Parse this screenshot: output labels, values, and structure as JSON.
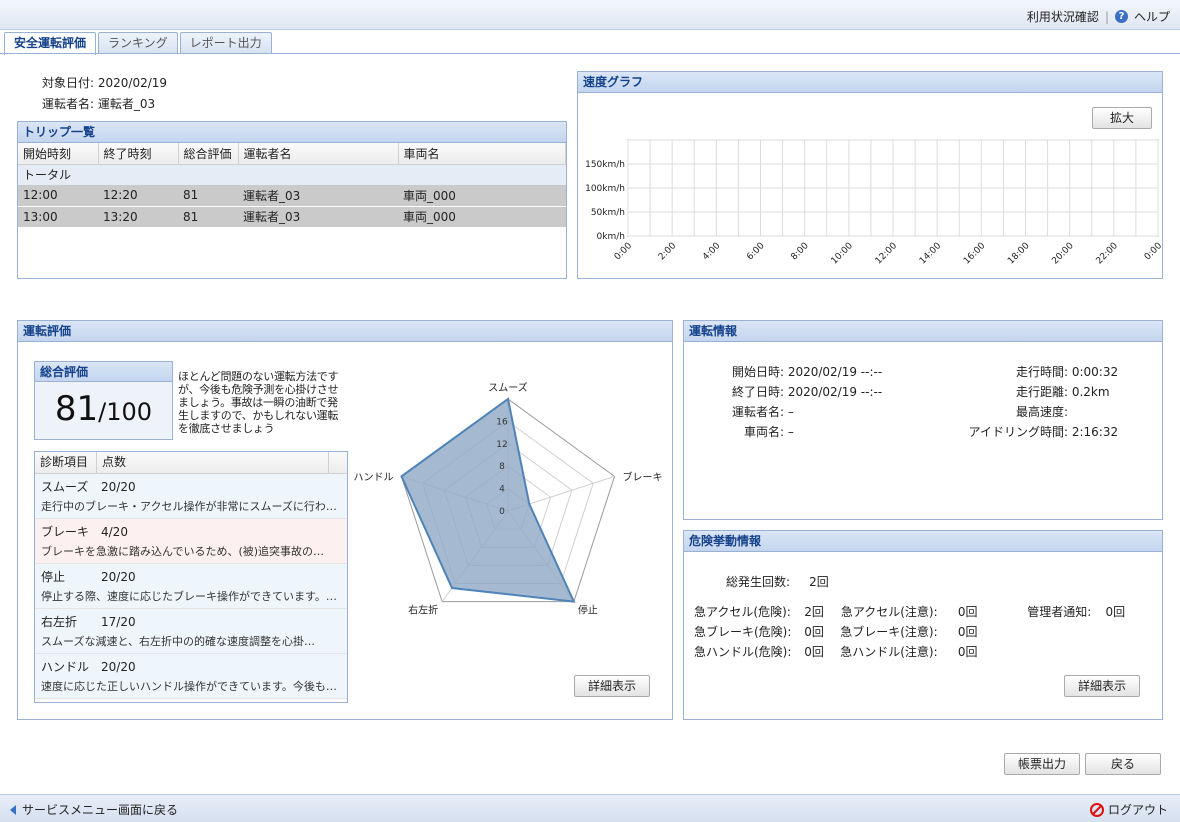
{
  "header": {
    "usage_link": "利用状況確認",
    "help_link": "ヘルプ"
  },
  "tabs": [
    {
      "label": "安全運転評価",
      "active": true
    },
    {
      "label": "ランキング",
      "active": false
    },
    {
      "label": "レポート出力",
      "active": false
    }
  ],
  "target": {
    "date_label": "対象日付:",
    "date": "2020/02/19",
    "driver_label": "運転者名:",
    "driver": "運転者_03"
  },
  "trips": {
    "title": "トリップ一覧",
    "columns": [
      "開始時刻",
      "終了時刻",
      "総合評価",
      "運転者名",
      "車両名"
    ],
    "total_label": "トータル",
    "rows": [
      [
        "12:00",
        "12:20",
        "81",
        "運転者_03",
        "車両_000"
      ],
      [
        "13:00",
        "13:20",
        "81",
        "運転者_03",
        "車両_000"
      ]
    ]
  },
  "speed_graph": {
    "title": "速度グラフ",
    "zoom_label": "拡大",
    "y_ticks": [
      "0km/h",
      "50km/h",
      "100km/h",
      "150km/h"
    ],
    "x_ticks": [
      "0:00",
      "2:00",
      "4:00",
      "6:00",
      "8:00",
      "10:00",
      "12:00",
      "14:00",
      "16:00",
      "18:00",
      "20:00",
      "22:00",
      "0:00"
    ]
  },
  "evaluation": {
    "title": "運転評価",
    "score_title": "総合評価",
    "score": "81",
    "score_max": "/100",
    "comment": "ほとんど問題のない運転方法ですが、今後も危険予測を心掛けさせましょう。事故は一瞬の油断で発生しますので、かもしれない運転を徹底させましょう",
    "diag_columns": [
      "診断項目",
      "点数"
    ],
    "items": [
      {
        "name": "スムーズ",
        "score": "20/20",
        "desc": "走行中のブレーキ・アクセル操作が非常にスムーズに行わ…",
        "tone": "blue"
      },
      {
        "name": "ブレーキ",
        "score": "4/20",
        "desc": "ブレーキを急激に踏み込んでいるため、(被)追突事故の…",
        "tone": "pink"
      },
      {
        "name": "停止",
        "score": "20/20",
        "desc": "停止する際、速度に応じたブレーキ操作ができています。…",
        "tone": "blue"
      },
      {
        "name": "右左折",
        "score": "17/20",
        "desc": "スムーズな減速と、右左折中の的確な速度調整を心掛…",
        "tone": "blue"
      },
      {
        "name": "ハンドル",
        "score": "20/20",
        "desc": "速度に応じた正しいハンドル操作ができています。今後も…",
        "tone": "blue"
      }
    ],
    "detail_label": "詳細表示"
  },
  "chart_data": {
    "type": "radar",
    "categories": [
      "スムーズ",
      "ブレーキ",
      "停止",
      "右左折",
      "ハンドル"
    ],
    "values": [
      20,
      4,
      20,
      17,
      20
    ],
    "ticks": [
      "0",
      "4",
      "8",
      "12",
      "16"
    ],
    "range": [
      0,
      20
    ],
    "fill": "#8fa9c4",
    "stroke": "#4f83b8"
  },
  "driving_info": {
    "title": "運転情報",
    "left": [
      {
        "k": "開始日時:",
        "v": "2020/02/19 --:--"
      },
      {
        "k": "終了日時:",
        "v": "2020/02/19 --:--"
      },
      {
        "k": "運転者名:",
        "v": "–"
      },
      {
        "k": "車両名:",
        "v": "–"
      }
    ],
    "right": [
      {
        "k": "走行時間:",
        "v": "0:00:32"
      },
      {
        "k": "走行距離:",
        "v": "0.2km"
      },
      {
        "k": "最高速度:",
        "v": ""
      },
      {
        "k": "アイドリング時間:",
        "v": "2:16:32"
      }
    ]
  },
  "danger_info": {
    "title": "危険挙動情報",
    "total_label": "総発生回数:",
    "total": "2回",
    "rows": [
      {
        "k1": "急アクセル(危険):",
        "v1": "2回",
        "k2": "急アクセル(注意):",
        "v2": "0回",
        "k3": "管理者通知:",
        "v3": "0回"
      },
      {
        "k1": "急ブレーキ(危険):",
        "v1": "0回",
        "k2": "急ブレーキ(注意):",
        "v2": "0回"
      },
      {
        "k1": "急ハンドル(危険):",
        "v1": "0回",
        "k2": "急ハンドル(注意):",
        "v2": "0回"
      }
    ],
    "detail_label": "詳細表示"
  },
  "actions": {
    "report": "帳票出力",
    "back": "戻る"
  },
  "footer": {
    "back_menu": "サービスメニュー画面に戻る",
    "logout": "ログアウト"
  }
}
